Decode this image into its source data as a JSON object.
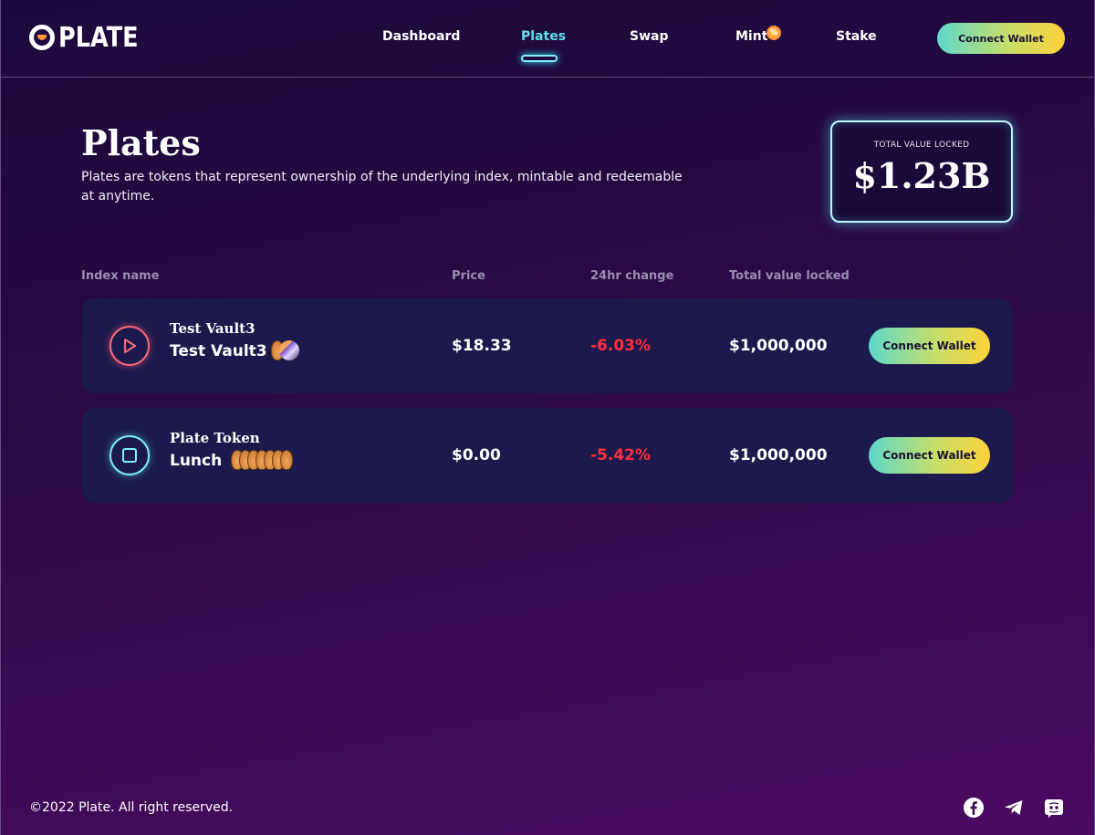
{
  "brand": {
    "name": "PLATE"
  },
  "nav": {
    "items": [
      {
        "label": "Dashboard",
        "active": false
      },
      {
        "label": "Plates",
        "active": true
      },
      {
        "label": "Swap",
        "active": false
      },
      {
        "label": "Mint",
        "active": false,
        "badge": "%"
      },
      {
        "label": "Stake",
        "active": false
      }
    ],
    "connect_label": "Connect Wallet"
  },
  "hero": {
    "title": "Plates",
    "subtitle": "Plates are tokens that represent ownership of the underlying index, mintable and redeemable at anytime.",
    "tvl_label": "TOTAL VALUE LOCKED",
    "tvl_value": "$1.23B"
  },
  "table": {
    "columns": [
      "Index name",
      "Price",
      "24hr change",
      "Total value locked"
    ],
    "rows": [
      {
        "name": "Test Vault3",
        "subname": "Test Vault3",
        "icon": "play-icon",
        "token_icons": [
          "pancake-token-icon",
          "sushi-token-icon"
        ],
        "price": "$18.33",
        "change": "-6.03%",
        "tvl": "$1,000,000",
        "action": "Connect Wallet"
      },
      {
        "name": "Plate Token",
        "subname": "Lunch",
        "icon": "stop-icon",
        "token_icons": [
          "pancake-token-icon",
          "pancake-token-icon",
          "pancake-token-icon",
          "pancake-token-icon",
          "pancake-token-icon",
          "pancake-token-icon",
          "pancake-token-icon"
        ],
        "price": "$0.00",
        "change": "-5.42%",
        "tvl": "$1,000,000",
        "action": "Connect Wallet"
      }
    ]
  },
  "footer": {
    "copyright": "©2022 Plate. All right reserved.",
    "social": [
      "facebook-icon",
      "telegram-icon",
      "discord-icon"
    ]
  },
  "colors": {
    "accent_cyan": "#5fe0e8",
    "negative": "#ff2d3c",
    "row_bg": "#1c1a4c",
    "button_gradient": [
      "#5ed8cc",
      "#ffd23a"
    ]
  }
}
